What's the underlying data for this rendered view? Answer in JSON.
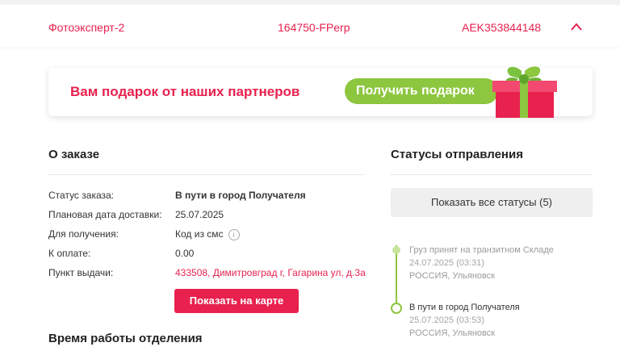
{
  "top_row": {
    "product": "Фотоэксперт-2",
    "order_code": "164750-FPerp",
    "tracking": "AEK353844148"
  },
  "banner": {
    "text": "Вам подарок от наших партнеров",
    "button_label": "Получить подарок"
  },
  "order": {
    "title": "О заказе",
    "rows": [
      {
        "label": "Статус заказа:",
        "value": "В пути в город Получателя"
      },
      {
        "label": "Плановая дата доставки:",
        "value": "25.07.2025"
      },
      {
        "label": "Для получения:",
        "value": "Код из смс"
      },
      {
        "label": "К оплате:",
        "value": "0.00"
      },
      {
        "label": "Пункт выдачи:",
        "value": "433508, Димитровград г, Гагарина ул, д.3а"
      }
    ],
    "info_glyph": "i",
    "map_button": "Показать на карте",
    "hours_title": "Время работы отделения"
  },
  "statuses": {
    "title": "Статусы отправления",
    "show_all_button": "Показать все статусы (5)",
    "items": [
      {
        "title": "Груз принят на транзитном Складе",
        "time": "24.07.2025 (03:31)",
        "place": "РОССИЯ, Ульяновск"
      },
      {
        "title": "В пути в город Получателя",
        "time": "25.07.2025 (03:53)",
        "place": "РОССИЯ, Ульяновск"
      }
    ]
  },
  "colors": {
    "accent": "#e8214e",
    "green": "#8dc63f",
    "muted_text": "#9a9a9a",
    "timeline_time": "#a6a6a6"
  }
}
